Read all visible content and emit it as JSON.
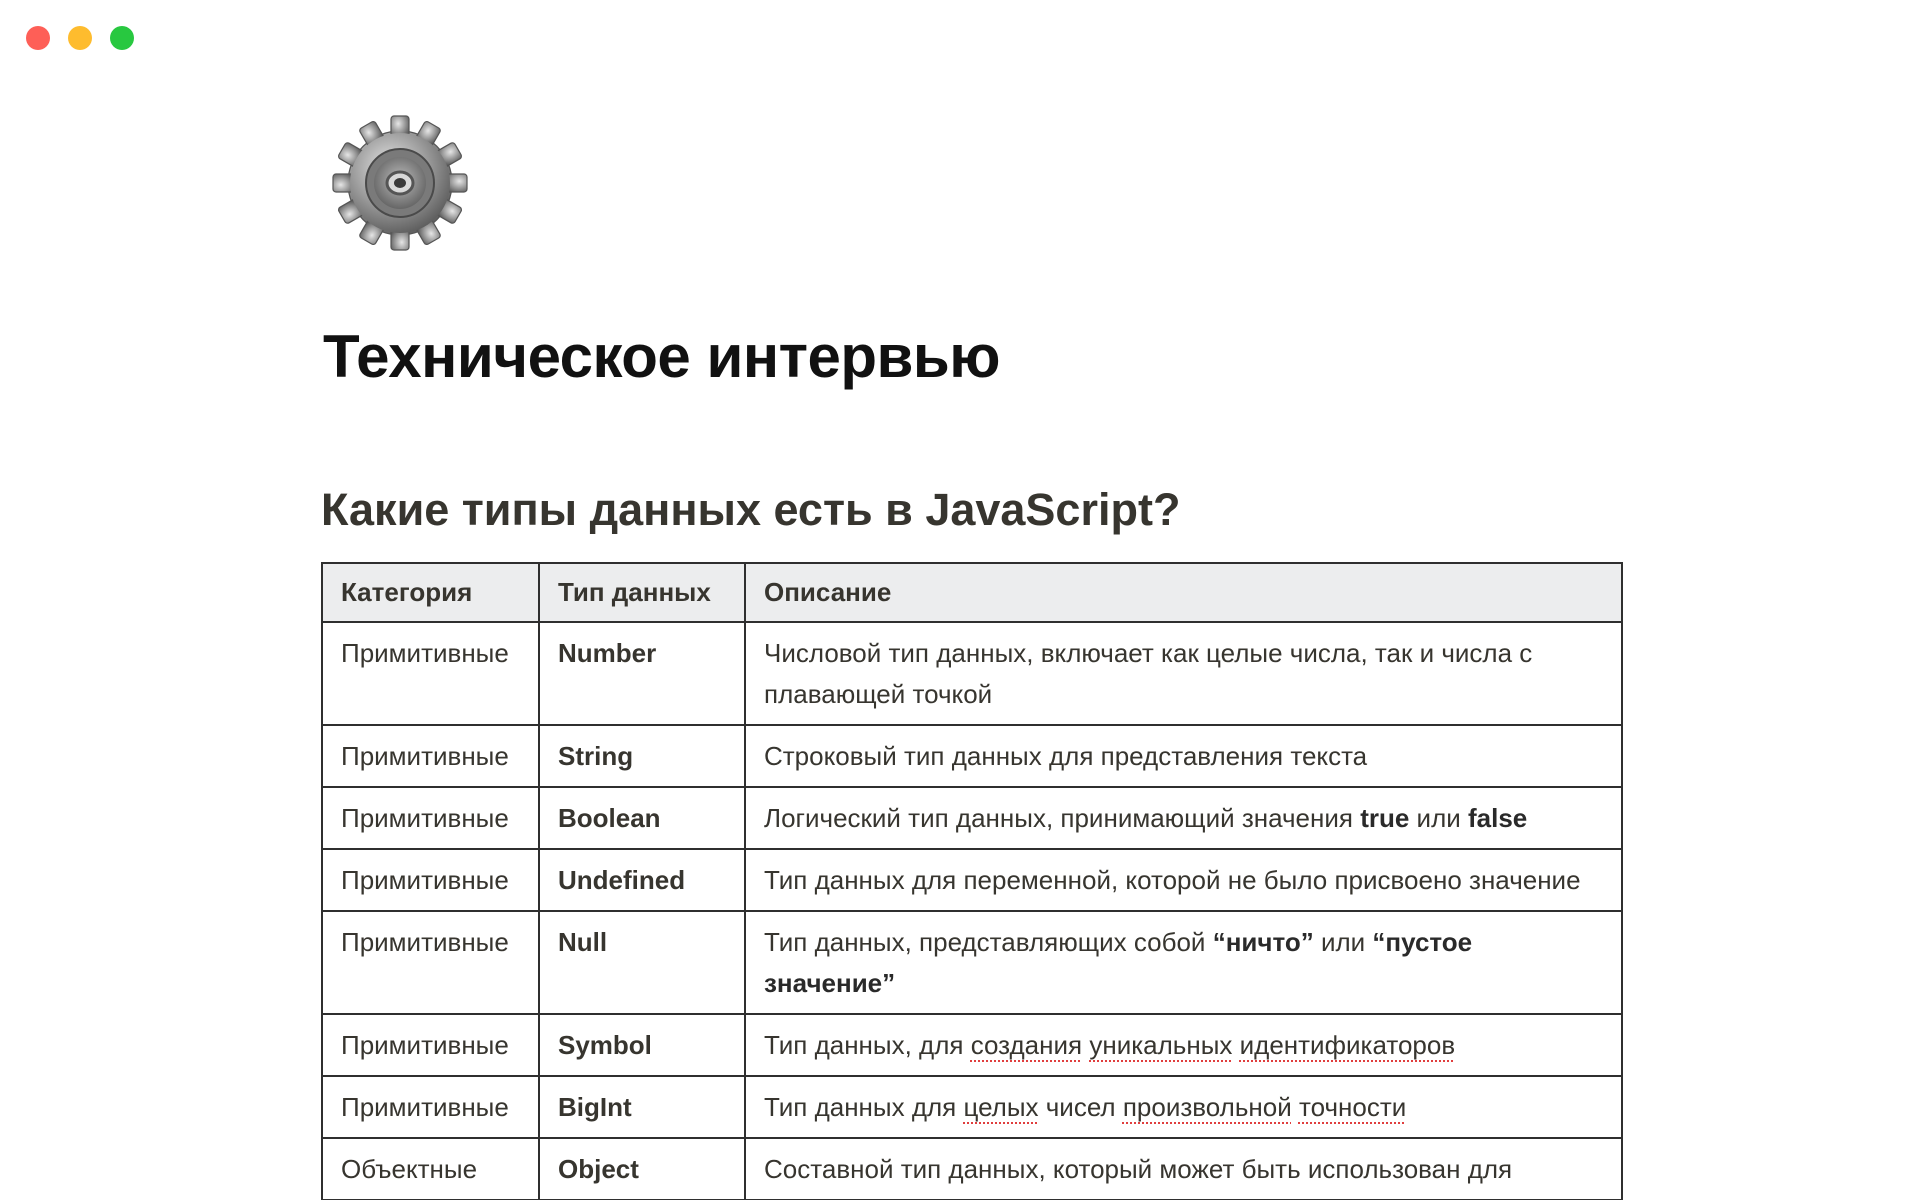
{
  "window": {
    "controls": [
      "close",
      "minimize",
      "maximize"
    ]
  },
  "page": {
    "icon": "gear-icon",
    "title": "Техническое интервью"
  },
  "section": {
    "heading": "Какие типы данных есть в JavaScript?"
  },
  "table": {
    "headers": [
      "Категория",
      "Тип данных",
      "Описание"
    ],
    "rows": [
      {
        "category": "Примитивные",
        "type": "Number",
        "description": [
          "Числовой тип данных, включает как целые числа, так и числа с плавающей точкой"
        ]
      },
      {
        "category": "Примитивные",
        "type": "String",
        "description": [
          "Строковый тип данных для представления текста"
        ]
      },
      {
        "category": "Примитивные",
        "type": "Boolean",
        "description": [
          "Логический тип данных, принимающий значения ",
          "true",
          " или ",
          "false"
        ]
      },
      {
        "category": "Примитивные",
        "type": "Undefined",
        "description": [
          "Тип данных для переменной, которой не было присвоено значение"
        ]
      },
      {
        "category": "Примитивные",
        "type": "Null",
        "description": [
          "Тип данных, представляющих собой ",
          "“ничто”",
          " или ",
          "“пустое значение”"
        ]
      },
      {
        "category": "Примитивные",
        "type": "Symbol",
        "description": [
          "Тип данных, для ",
          "создания",
          " ",
          "уникальных",
          " ",
          "идентификаторов"
        ]
      },
      {
        "category": "Примитивные",
        "type": "BigInt",
        "description": [
          "Тип данных для ",
          "целых",
          " чисел ",
          "произвольной",
          " ",
          "точности"
        ]
      },
      {
        "category": "Объектные",
        "type": "Object",
        "description": [
          "Составной тип данных, который может быть использован для"
        ]
      }
    ]
  }
}
